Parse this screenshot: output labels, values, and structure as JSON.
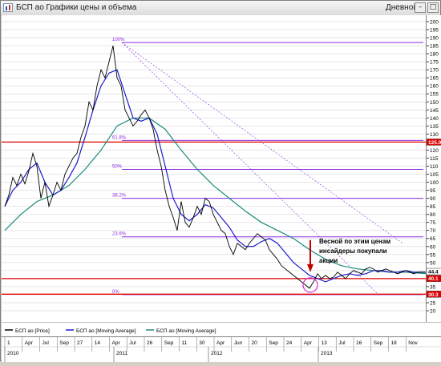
{
  "window": {
    "title": "БСП ао Графики цены и объема",
    "period": "Дневной",
    "controls": [
      "–",
      "□",
      "✕"
    ]
  },
  "annotation": {
    "lines": [
      "Весной по этим ценам",
      "инсайдеры покупали",
      "акции"
    ]
  },
  "legend": [
    {
      "label": "БСП ао [Price]",
      "color": "#000000"
    },
    {
      "label": "БСП ао [Moving Average]",
      "color": "#1c1ccc"
    },
    {
      "label": "БСП ао [Moving Average]",
      "color": "#1a8c7c"
    }
  ],
  "fib_levels": [
    {
      "label": "100%",
      "value": 187
    },
    {
      "label": "61.8%",
      "value": 126
    },
    {
      "label": "50%",
      "value": 108
    },
    {
      "label": "38.2%",
      "value": 90
    },
    {
      "label": "23.6%",
      "value": 66
    },
    {
      "label": "0%",
      "value": 30
    }
  ],
  "chart_data": {
    "type": "line",
    "ylim": [
      15,
      200
    ],
    "y_ticks": [
      20,
      25,
      30,
      35,
      40,
      45,
      50,
      55,
      60,
      65,
      70,
      75,
      80,
      85,
      90,
      95,
      100,
      105,
      110,
      115,
      120,
      125,
      130,
      135,
      140,
      145,
      150,
      155,
      160,
      165,
      170,
      175,
      180,
      185,
      190,
      195,
      200
    ],
    "x_months": [
      "1",
      "Apr",
      "Jul",
      "Sep",
      "27",
      "14",
      "Apr",
      "Jul",
      "26",
      "Sep",
      "11",
      "30",
      "Apr",
      "Jun",
      "20",
      "Sep",
      "24",
      "Apr",
      "13",
      "Jul",
      "16",
      "Sep",
      "18",
      "Nov"
    ],
    "x_years": [
      "2010",
      "2011",
      "2012",
      "2013"
    ],
    "price_flags": [
      {
        "label": "44.4",
        "value": 44.4,
        "bg": "#ffffff",
        "color": "#000000"
      },
      {
        "label": "40.1",
        "value": 40.1,
        "bg": "#e00000",
        "color": "#ffffff"
      },
      {
        "label": "125.0",
        "value": 125.0,
        "bg": "#e00000",
        "color": "#ffffff"
      },
      {
        "label": "30.3",
        "value": 30.3,
        "bg": "#e00000",
        "color": "#ffffff"
      }
    ],
    "horizontal_lines": [
      {
        "value": 125,
        "color": "#e00000"
      },
      {
        "value": 40,
        "color": "#e00000"
      },
      {
        "value": 30.3,
        "color": "#e00000"
      }
    ],
    "series": [
      {
        "name": "БСП ао [Price]",
        "color": "#000000",
        "x": [
          0,
          5,
          10,
          15,
          20,
          25,
          30,
          35,
          40,
          45,
          50,
          55,
          60,
          65,
          70,
          75,
          80,
          85,
          90,
          95,
          100,
          105,
          110,
          115,
          120,
          125,
          130,
          135,
          140,
          145,
          150,
          155,
          160,
          165,
          170,
          175,
          180,
          185,
          190,
          195,
          200,
          205,
          210,
          215,
          220,
          225,
          230,
          235,
          240,
          245,
          250,
          255,
          260,
          265,
          270,
          275,
          280,
          285,
          290,
          295,
          300,
          305,
          310,
          315,
          320,
          325,
          330,
          335,
          340,
          345,
          350,
          355,
          360,
          365,
          370,
          375,
          380,
          385,
          390,
          395,
          400,
          405,
          410,
          415,
          420,
          425,
          430,
          435,
          440,
          445,
          450,
          455,
          460,
          465,
          470,
          475,
          480,
          485,
          490,
          495,
          500,
          505,
          510,
          515,
          520,
          525,
          528
        ],
        "y": [
          85,
          92,
          103,
          98,
          105,
          99,
          107,
          118,
          110,
          90,
          100,
          85,
          92,
          100,
          95,
          105,
          110,
          115,
          118,
          128,
          135,
          150,
          145,
          160,
          170,
          165,
          175,
          185,
          165,
          160,
          145,
          140,
          135,
          138,
          142,
          145,
          140,
          133,
          120,
          110,
          95,
          85,
          78,
          70,
          88,
          75,
          72,
          78,
          85,
          80,
          90,
          88,
          80,
          75,
          70,
          68,
          60,
          55,
          62,
          60,
          58,
          62,
          65,
          68,
          66,
          64,
          58,
          55,
          52,
          48,
          46,
          44,
          42,
          40,
          38,
          36,
          34,
          38,
          43,
          40,
          42,
          40,
          41,
          44,
          42,
          40,
          43,
          45,
          44,
          43,
          46,
          47,
          46,
          44,
          45,
          46,
          45,
          44,
          43,
          44,
          45,
          44,
          43,
          44,
          44,
          44,
          44
        ]
      },
      {
        "name": "БСП ао [Moving Average]",
        "color": "#1c1ccc",
        "x": [
          0,
          10,
          20,
          30,
          40,
          50,
          60,
          70,
          80,
          90,
          100,
          110,
          120,
          130,
          140,
          150,
          160,
          170,
          180,
          190,
          200,
          210,
          220,
          230,
          240,
          250,
          260,
          270,
          280,
          290,
          300,
          310,
          320,
          330,
          340,
          350,
          360,
          370,
          380,
          390,
          400,
          410,
          420,
          430,
          440,
          450,
          460,
          470,
          480,
          490,
          500,
          510,
          520,
          528
        ],
        "y": [
          85,
          95,
          100,
          108,
          112,
          100,
          92,
          95,
          103,
          112,
          128,
          145,
          160,
          168,
          170,
          155,
          140,
          138,
          140,
          130,
          110,
          90,
          80,
          76,
          80,
          86,
          84,
          78,
          72,
          64,
          60,
          60,
          63,
          65,
          62,
          56,
          50,
          46,
          42,
          40,
          38,
          40,
          42,
          43,
          42,
          43,
          45,
          45,
          44,
          44,
          45,
          44,
          44,
          44
        ]
      },
      {
        "name": "БСП ао [Moving Average]",
        "color": "#1a8c7c",
        "x": [
          0,
          20,
          40,
          60,
          80,
          100,
          120,
          140,
          160,
          180,
          200,
          220,
          240,
          260,
          280,
          300,
          320,
          340,
          360,
          380,
          400,
          420,
          440,
          460,
          480,
          500,
          528
        ],
        "y": [
          70,
          80,
          88,
          92,
          98,
          108,
          120,
          135,
          140,
          140,
          133,
          120,
          108,
          98,
          90,
          82,
          75,
          70,
          65,
          58,
          52,
          48,
          46,
          45,
          44,
          44,
          43
        ]
      }
    ]
  }
}
